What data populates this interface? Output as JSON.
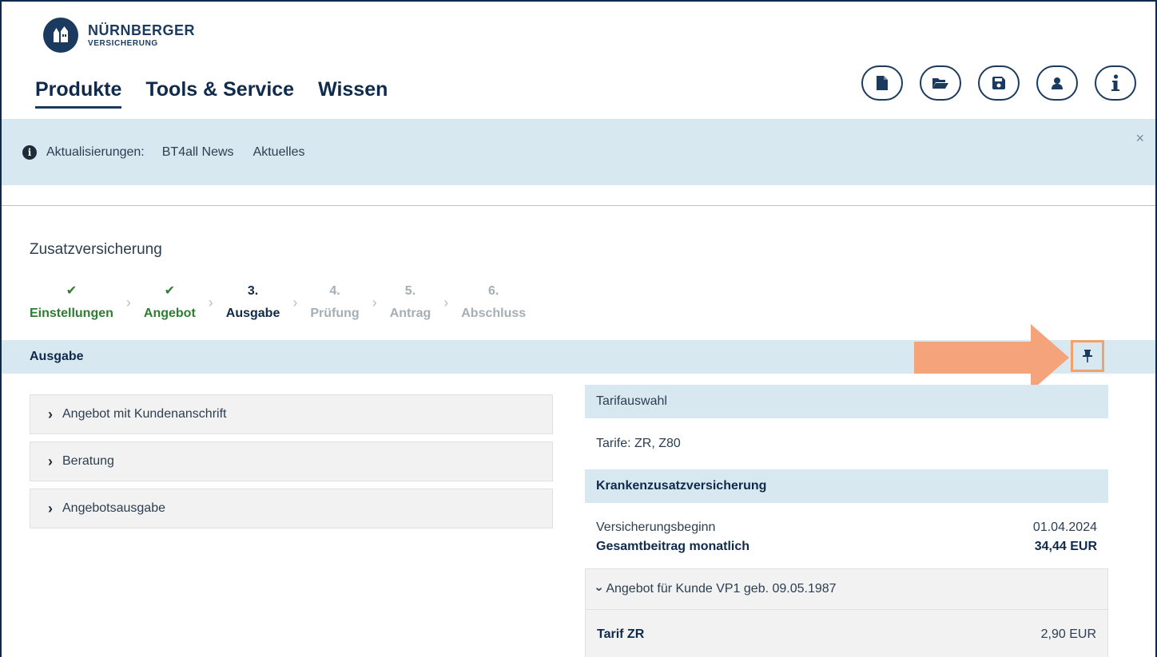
{
  "brand": {
    "name": "NÜRNBERGER",
    "sub": "VERSICHERUNG"
  },
  "nav": {
    "items": [
      {
        "label": "Produkte",
        "active": true
      },
      {
        "label": "Tools & Service",
        "active": false
      },
      {
        "label": "Wissen",
        "active": false
      }
    ]
  },
  "toolbar": {
    "icons": [
      "new-document-icon",
      "open-folder-icon",
      "save-icon",
      "user-icon",
      "info-icon"
    ]
  },
  "infobar": {
    "label": "Aktualisierungen:",
    "links": [
      "BT4all News",
      "Aktuelles"
    ],
    "close": "×"
  },
  "page": {
    "title": "Zusatzversicherung"
  },
  "stepper": {
    "steps": [
      {
        "number": "✔",
        "label": "Einstellungen",
        "state": "done"
      },
      {
        "number": "✔",
        "label": "Angebot",
        "state": "done"
      },
      {
        "number": "3.",
        "label": "Ausgabe",
        "state": "current"
      },
      {
        "number": "4.",
        "label": "Prüfung",
        "state": "todo"
      },
      {
        "number": "5.",
        "label": "Antrag",
        "state": "todo"
      },
      {
        "number": "6.",
        "label": "Abschluss",
        "state": "todo"
      }
    ],
    "separator": "›"
  },
  "section": {
    "title": "Ausgabe"
  },
  "accordion": {
    "items": [
      "Angebot mit Kundenanschrift",
      "Beratung",
      "Angebotsausgabe"
    ],
    "chevron": "›"
  },
  "summary": {
    "tarifauswahl_title": "Tarifauswahl",
    "tarife": "Tarife: ZR, Z80",
    "kzv_title": "Krankenzusatzversicherung",
    "beginn_label": "Versicherungsbeginn",
    "beginn_value": "01.04.2024",
    "gesamt_label": "Gesamtbeitrag monatlich",
    "gesamt_value": "34,44 EUR",
    "angebot_label": "Angebot für Kunde VP1 geb. 09.05.1987",
    "tarif_label": "Tarif ZR",
    "tarif_value": "2,90 EUR"
  },
  "colors": {
    "accent": "#1b3a5f",
    "done": "#2e7d32",
    "highlight": "#f3a06a",
    "bar": "#d8e8f1"
  }
}
